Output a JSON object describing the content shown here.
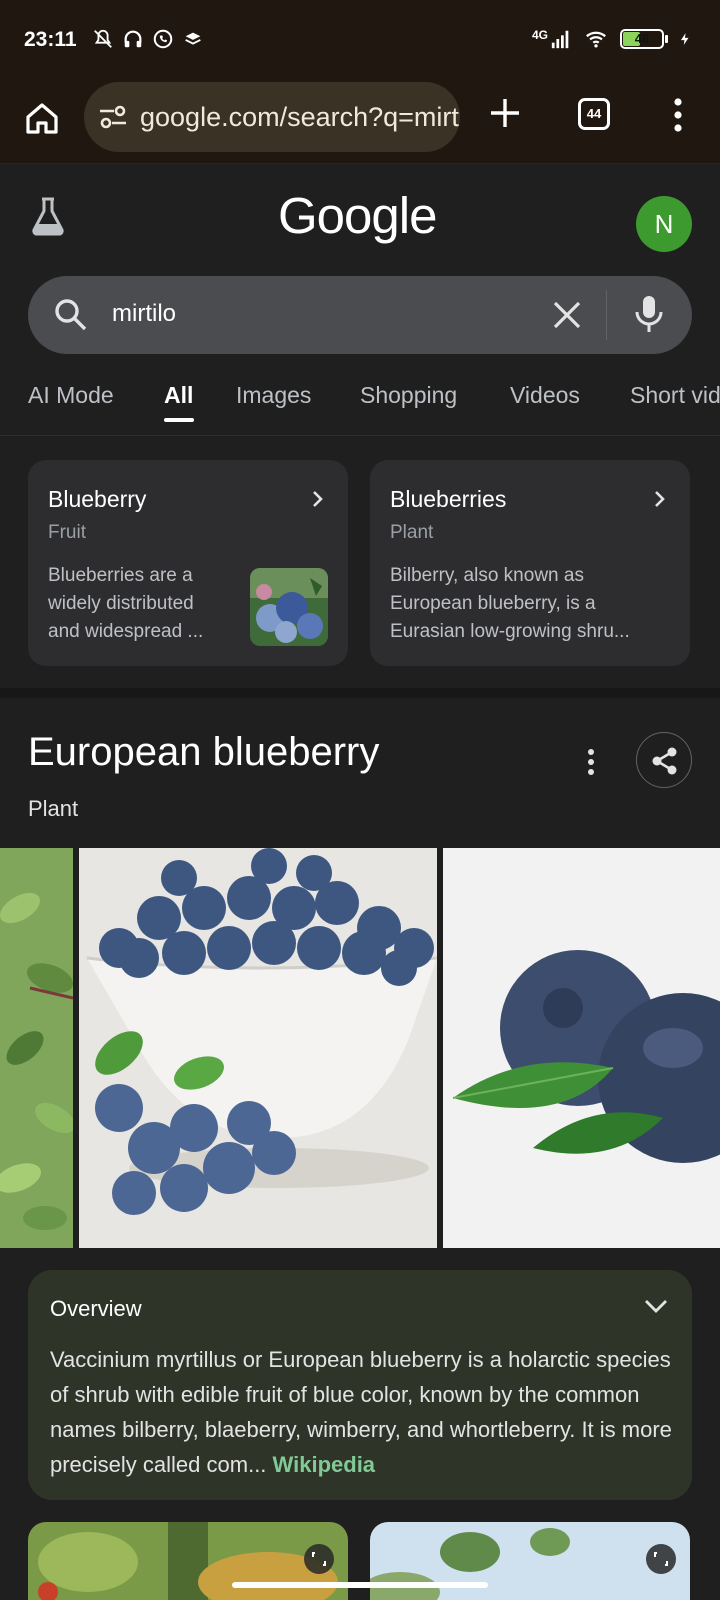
{
  "status_bar": {
    "time": "23:11",
    "network": "4G",
    "battery_level": "46",
    "battery_color": "#8bd35a"
  },
  "browser": {
    "url": "google.com/search?q=mirtilo",
    "tab_count": "44",
    "home_icon": "home-icon",
    "new_tab_icon": "plus-icon",
    "menu_icon": "more-vert-icon"
  },
  "google": {
    "logo": "Google",
    "avatar_letter": "N",
    "avatar_color": "#3c9a2f"
  },
  "search": {
    "query": "mirtilo"
  },
  "tabs": [
    {
      "label": "AI Mode"
    },
    {
      "label": "All"
    },
    {
      "label": "Images"
    },
    {
      "label": "Shopping"
    },
    {
      "label": "Videos"
    },
    {
      "label": "Short videos"
    }
  ],
  "entity_cards": [
    {
      "title": "Blueberry",
      "type": "Fruit",
      "description": "Blueberries are a widely distributed and widespread ..."
    },
    {
      "title": "Blueberries",
      "type": "Plant",
      "description": "Bilberry, also known as European blueberry, is a Eurasian low-growing shru..."
    }
  ],
  "knowledge_panel": {
    "title": "European blueberry",
    "subtitle": "Plant",
    "overview_title": "Overview",
    "overview_text": "Vaccinium myrtillus or European blueberry is a holarctic species of shrub with edible fruit of blue color, known by the common names bilberry, blaeberry, wimberry, and whortleberry. It is more precisely called com...",
    "source": "Wikipedia"
  }
}
